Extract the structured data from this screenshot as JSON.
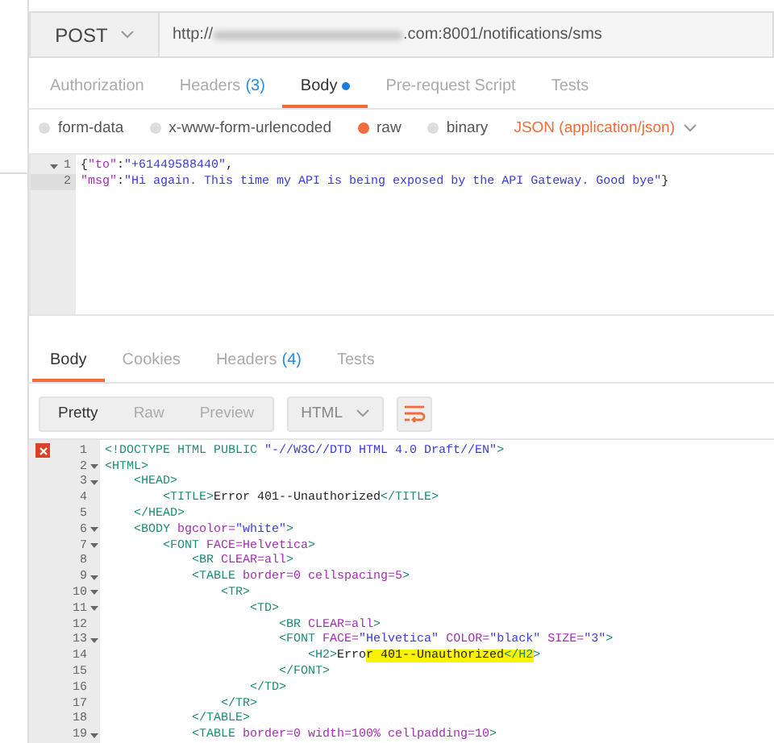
{
  "request": {
    "method": "POST",
    "url_prefix": "http://",
    "url_suffix": ".com:8001/notifications/sms"
  },
  "request_tabs": [
    {
      "label": "Authorization",
      "selected": false,
      "dot": false
    },
    {
      "label": "Headers",
      "count": "(3)",
      "selected": false,
      "dot": false
    },
    {
      "label": "Body",
      "selected": true,
      "dot": true
    },
    {
      "label": "Pre-request Script",
      "selected": false,
      "dot": false
    },
    {
      "label": "Tests",
      "selected": false,
      "dot": false
    }
  ],
  "body_types": [
    {
      "label": "form-data",
      "selected": false
    },
    {
      "label": "x-www-form-urlencoded",
      "selected": false
    },
    {
      "label": "raw",
      "selected": true
    },
    {
      "label": "binary",
      "selected": false
    }
  ],
  "content_type": "JSON (application/json)",
  "request_body": [
    {
      "number": "1",
      "foldable": true,
      "tokens": [
        {
          "kind": "text",
          "text": "{"
        },
        {
          "kind": "key",
          "text": "\"to\""
        },
        {
          "kind": "text",
          "text": ":"
        },
        {
          "kind": "value",
          "text": "\"+61449588440\""
        },
        {
          "kind": "text",
          "text": ","
        }
      ]
    },
    {
      "number": "2",
      "foldable": false,
      "tokens": [
        {
          "kind": "key",
          "text": "\"msg\""
        },
        {
          "kind": "text",
          "text": ":"
        },
        {
          "kind": "value",
          "text": "\"Hi again. This time my API is being exposed by the API Gateway. Good bye\""
        },
        {
          "kind": "text",
          "text": "}"
        }
      ]
    }
  ],
  "response_tabs": [
    {
      "label": "Body",
      "selected": true
    },
    {
      "label": "Cookies",
      "selected": false
    },
    {
      "label": "Headers",
      "count": "(4)",
      "selected": false
    },
    {
      "label": "Tests",
      "selected": false
    }
  ],
  "view_modes": [
    {
      "label": "Pretty",
      "selected": true
    },
    {
      "label": "Raw",
      "selected": false
    },
    {
      "label": "Preview",
      "selected": false
    }
  ],
  "format": "HTML",
  "response_body": [
    {
      "number": "1",
      "error": true,
      "foldable": false,
      "tokens": [
        {
          "kind": "tag",
          "text": "<!DOCTYPE HTML PUBLIC "
        },
        {
          "kind": "value",
          "text": "\"-//W3C//DTD HTML 4.0 Draft//EN\""
        },
        {
          "kind": "tag",
          "text": ">"
        }
      ]
    },
    {
      "number": "2",
      "error": false,
      "foldable": true,
      "tokens": [
        {
          "kind": "tag",
          "text": "<HTML>"
        }
      ]
    },
    {
      "number": "3",
      "error": false,
      "foldable": true,
      "tokens": [
        {
          "kind": "tag",
          "text": "    <HEAD>"
        }
      ]
    },
    {
      "number": "4",
      "error": false,
      "foldable": false,
      "tokens": [
        {
          "kind": "tag",
          "text": "        <TITLE>"
        },
        {
          "kind": "text",
          "text": "Error 401--Unauthorized"
        },
        {
          "kind": "tag",
          "text": "</TITLE>"
        }
      ]
    },
    {
      "number": "5",
      "error": false,
      "foldable": false,
      "tokens": [
        {
          "kind": "tag",
          "text": "    </HEAD>"
        }
      ]
    },
    {
      "number": "6",
      "error": false,
      "foldable": true,
      "tokens": [
        {
          "kind": "tag",
          "text": "    <BODY "
        },
        {
          "kind": "attr",
          "text": "bgcolor="
        },
        {
          "kind": "value",
          "text": "\"white\""
        },
        {
          "kind": "tag",
          "text": ">"
        }
      ]
    },
    {
      "number": "7",
      "error": false,
      "foldable": true,
      "tokens": [
        {
          "kind": "tag",
          "text": "        <FONT "
        },
        {
          "kind": "attr",
          "text": "FACE=Helvetica"
        },
        {
          "kind": "tag",
          "text": ">"
        }
      ]
    },
    {
      "number": "8",
      "error": false,
      "foldable": false,
      "tokens": [
        {
          "kind": "tag",
          "text": "            <BR "
        },
        {
          "kind": "attr",
          "text": "CLEAR=all"
        },
        {
          "kind": "tag",
          "text": ">"
        }
      ]
    },
    {
      "number": "9",
      "error": false,
      "foldable": true,
      "tokens": [
        {
          "kind": "tag",
          "text": "            <TABLE "
        },
        {
          "kind": "attr",
          "text": "border=0 cellspacing=5"
        },
        {
          "kind": "tag",
          "text": ">"
        }
      ]
    },
    {
      "number": "10",
      "error": false,
      "foldable": true,
      "tokens": [
        {
          "kind": "tag",
          "text": "                <TR>"
        }
      ]
    },
    {
      "number": "11",
      "error": false,
      "foldable": true,
      "tokens": [
        {
          "kind": "tag",
          "text": "                    <TD>"
        }
      ]
    },
    {
      "number": "12",
      "error": false,
      "foldable": false,
      "tokens": [
        {
          "kind": "tag",
          "text": "                        <BR "
        },
        {
          "kind": "attr",
          "text": "CLEAR=all"
        },
        {
          "kind": "tag",
          "text": ">"
        }
      ]
    },
    {
      "number": "13",
      "error": false,
      "foldable": true,
      "tokens": [
        {
          "kind": "tag",
          "text": "                        <FONT "
        },
        {
          "kind": "attr",
          "text": "FACE="
        },
        {
          "kind": "value",
          "text": "\"Helvetica\""
        },
        {
          "kind": "attr",
          "text": " COLOR="
        },
        {
          "kind": "value",
          "text": "\"black\""
        },
        {
          "kind": "attr",
          "text": " SIZE="
        },
        {
          "kind": "value",
          "text": "\"3\""
        },
        {
          "kind": "tag",
          "text": ">"
        }
      ]
    },
    {
      "number": "14",
      "error": false,
      "foldable": false,
      "tokens": [
        {
          "kind": "tag",
          "text": "                            <H2>"
        },
        {
          "kind": "text",
          "text": "Erro"
        },
        {
          "kind": "text",
          "text": "r 401--Unauthorized",
          "highlighted": true
        },
        {
          "kind": "tag",
          "text": "</H2",
          "highlighted": true
        },
        {
          "kind": "tag",
          "text": ">"
        }
      ]
    },
    {
      "number": "15",
      "error": false,
      "foldable": false,
      "tokens": [
        {
          "kind": "tag",
          "text": "                        </FONT>"
        }
      ]
    },
    {
      "number": "16",
      "error": false,
      "foldable": false,
      "tokens": [
        {
          "kind": "tag",
          "text": "                    </TD>"
        }
      ]
    },
    {
      "number": "17",
      "error": false,
      "foldable": false,
      "tokens": [
        {
          "kind": "tag",
          "text": "                </TR>"
        }
      ]
    },
    {
      "number": "18",
      "error": false,
      "foldable": false,
      "tokens": [
        {
          "kind": "tag",
          "text": "            </TABLE>"
        }
      ]
    },
    {
      "number": "19",
      "error": false,
      "foldable": true,
      "tokens": [
        {
          "kind": "tag",
          "text": "            <TABLE "
        },
        {
          "kind": "attr",
          "text": "border=0 width=100% cellpadding=10"
        },
        {
          "kind": "tag",
          "text": ">"
        }
      ]
    }
  ]
}
